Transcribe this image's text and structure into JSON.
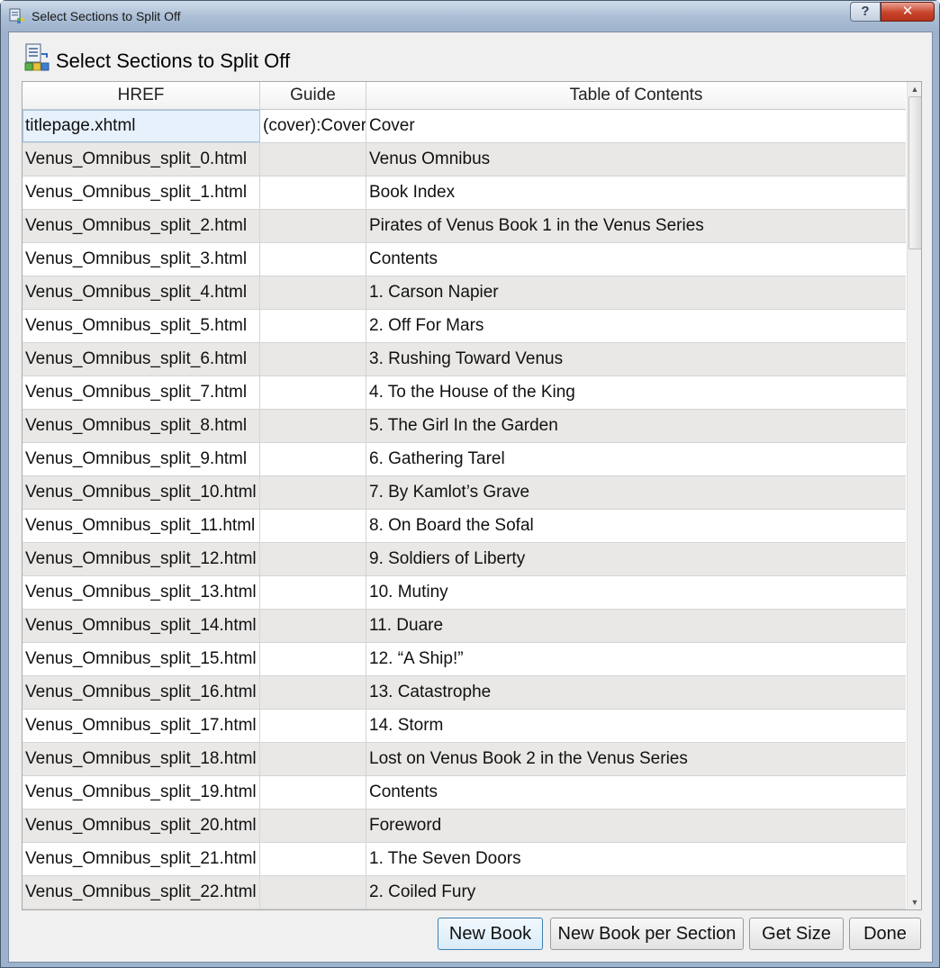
{
  "window": {
    "title": "Select Sections to Split Off",
    "help_label": "?",
    "close_label": "✕"
  },
  "dialog": {
    "heading": "Select Sections to Split Off"
  },
  "table": {
    "columns": [
      "HREF",
      "Guide",
      "Table of Contents"
    ],
    "rows": [
      {
        "href": "titlepage.xhtml",
        "guide": "(cover):Cover",
        "toc": "Cover"
      },
      {
        "href": "Venus_Omnibus_split_0.html",
        "guide": "",
        "toc": "Venus Omnibus"
      },
      {
        "href": "Venus_Omnibus_split_1.html",
        "guide": "",
        "toc": "Book Index"
      },
      {
        "href": "Venus_Omnibus_split_2.html",
        "guide": "",
        "toc": "Pirates of Venus Book 1 in the Venus Series"
      },
      {
        "href": "Venus_Omnibus_split_3.html",
        "guide": "",
        "toc": "Contents"
      },
      {
        "href": "Venus_Omnibus_split_4.html",
        "guide": "",
        "toc": "1. Carson Napier"
      },
      {
        "href": "Venus_Omnibus_split_5.html",
        "guide": "",
        "toc": "2. Off For Mars"
      },
      {
        "href": "Venus_Omnibus_split_6.html",
        "guide": "",
        "toc": "3. Rushing Toward Venus"
      },
      {
        "href": "Venus_Omnibus_split_7.html",
        "guide": "",
        "toc": "4. To the House of the King"
      },
      {
        "href": "Venus_Omnibus_split_8.html",
        "guide": "",
        "toc": "5. The Girl In the Garden"
      },
      {
        "href": "Venus_Omnibus_split_9.html",
        "guide": "",
        "toc": "6. Gathering Tarel"
      },
      {
        "href": "Venus_Omnibus_split_10.html",
        "guide": "",
        "toc": "7. By Kamlot’s Grave"
      },
      {
        "href": "Venus_Omnibus_split_11.html",
        "guide": "",
        "toc": "8. On Board the Sofal"
      },
      {
        "href": "Venus_Omnibus_split_12.html",
        "guide": "",
        "toc": "9. Soldiers of Liberty"
      },
      {
        "href": "Venus_Omnibus_split_13.html",
        "guide": "",
        "toc": "10. Mutiny"
      },
      {
        "href": "Venus_Omnibus_split_14.html",
        "guide": "",
        "toc": "11. Duare"
      },
      {
        "href": "Venus_Omnibus_split_15.html",
        "guide": "",
        "toc": "12. “A Ship!”"
      },
      {
        "href": "Venus_Omnibus_split_16.html",
        "guide": "",
        "toc": "13. Catastrophe"
      },
      {
        "href": "Venus_Omnibus_split_17.html",
        "guide": "",
        "toc": "14. Storm"
      },
      {
        "href": "Venus_Omnibus_split_18.html",
        "guide": "",
        "toc": "Lost on Venus Book 2 in the Venus Series"
      },
      {
        "href": "Venus_Omnibus_split_19.html",
        "guide": "",
        "toc": "Contents"
      },
      {
        "href": "Venus_Omnibus_split_20.html",
        "guide": "",
        "toc": "Foreword"
      },
      {
        "href": "Venus_Omnibus_split_21.html",
        "guide": "",
        "toc": "1. The Seven Doors"
      },
      {
        "href": "Venus_Omnibus_split_22.html",
        "guide": "",
        "toc": "2. Coiled Fury"
      }
    ]
  },
  "buttons": {
    "new_book": "New Book",
    "new_book_per_section": "New Book per Section",
    "get_size": "Get Size",
    "done": "Done"
  },
  "icons": {
    "app": "split-book-icon",
    "dialog": "split-book-icon",
    "scroll_up": "scroll-up-arrow-icon",
    "scroll_down": "scroll-down-arrow-icon"
  },
  "colors": {
    "title_bar": "#aabdd5",
    "close_button": "#c8432a",
    "row_alt": "#e9e8e6",
    "selection": "#e7f1fb"
  }
}
